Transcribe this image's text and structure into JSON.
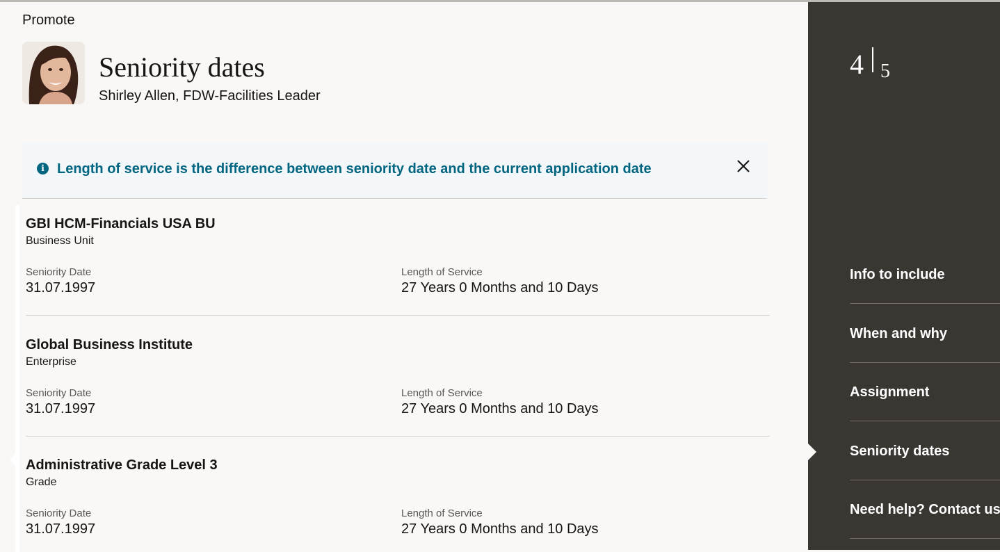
{
  "flow": {
    "title": "Promote"
  },
  "header": {
    "title": "Seniority dates",
    "person": "Shirley Allen, FDW-Facilities Leader",
    "avatar_icon": "person-photo"
  },
  "banner": {
    "icon": "info-icon",
    "text": "Length of service is the difference between seniority date and the current application date",
    "close_icon": "close-icon",
    "accent_color": "#036680"
  },
  "records": [
    {
      "name": "GBI HCM-Financials USA BU",
      "type": "Business Unit",
      "seniority_label": "Seniority Date",
      "seniority_value": "31.07.1997",
      "length_label": "Length of Service",
      "length_value": "27 Years 0 Months and 10 Days"
    },
    {
      "name": "Global Business Institute",
      "type": "Enterprise",
      "seniority_label": "Seniority Date",
      "seniority_value": "31.07.1997",
      "length_label": "Length of Service",
      "length_value": "27 Years 0 Months and 10 Days"
    },
    {
      "name": "Administrative Grade Level 3",
      "type": "Grade",
      "seniority_label": "Seniority Date",
      "seniority_value": "31.07.1997",
      "length_label": "Length of Service",
      "length_value": "27 Years 0 Months and 10 Days"
    }
  ],
  "sidebar": {
    "step_current": "4",
    "step_total": "5",
    "background": "#3a3631",
    "items": [
      {
        "label": "Info to include"
      },
      {
        "label": "When and why"
      },
      {
        "label": "Assignment"
      },
      {
        "label": "Seniority dates",
        "current": true
      },
      {
        "label": "Need help? Contact us."
      }
    ]
  }
}
